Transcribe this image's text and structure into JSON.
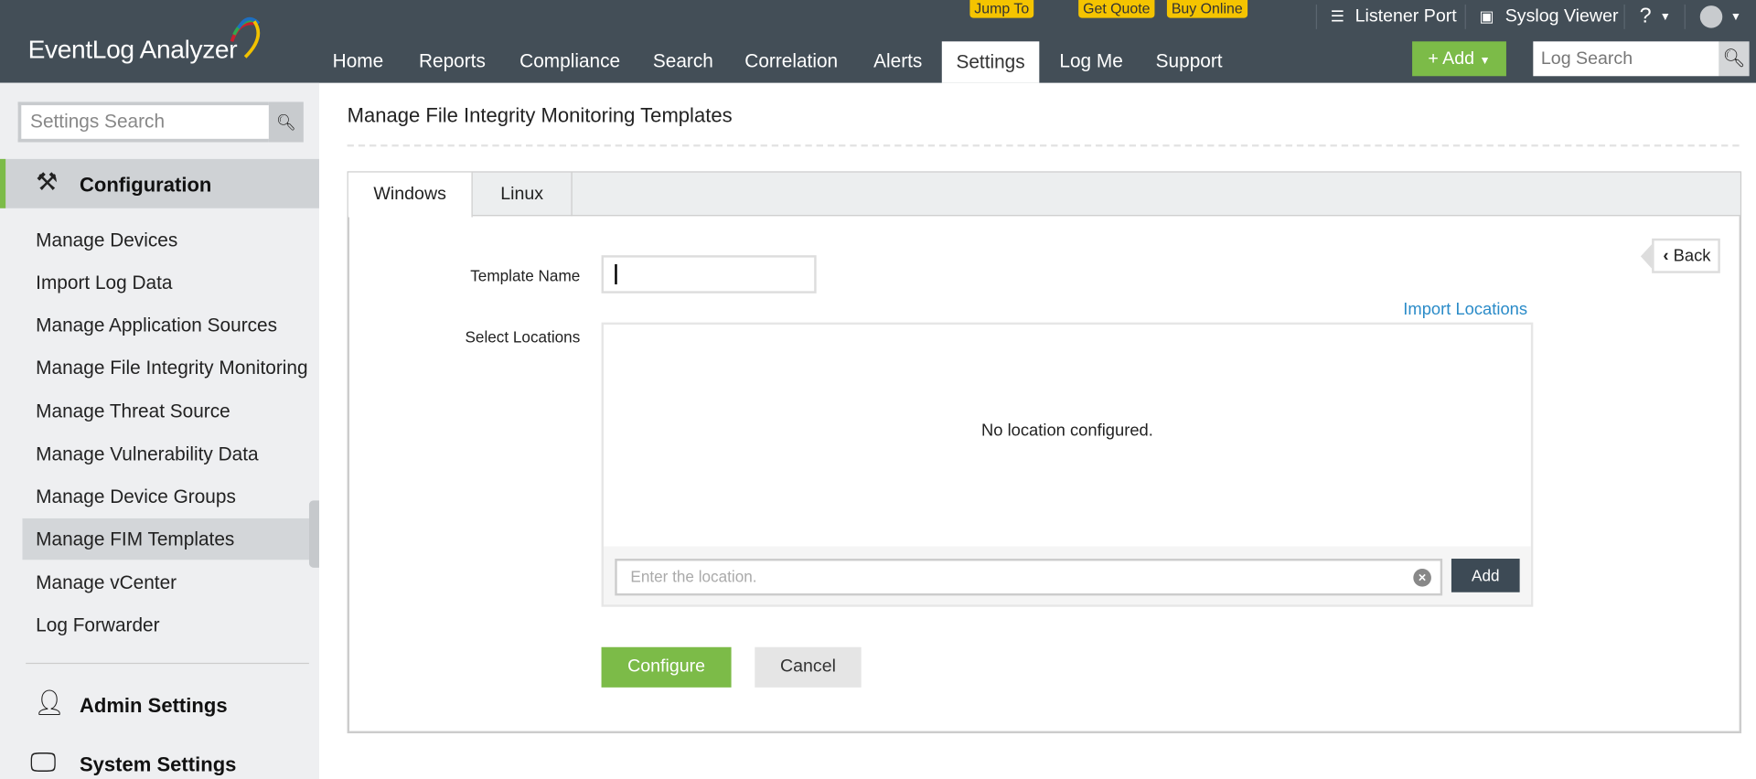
{
  "app": {
    "name": "EventLog Analyzer"
  },
  "header": {
    "nav": [
      "Home",
      "Reports",
      "Compliance",
      "Search",
      "Correlation",
      "Alerts",
      "Settings",
      "Log Me",
      "Support"
    ],
    "active_nav": "Settings",
    "badges": {
      "jump_to": "Jump To",
      "get_quote": "Get Quote",
      "buy_online": "Buy Online"
    },
    "listener_port": "Listener Port",
    "syslog_viewer": "Syslog Viewer",
    "help": "?",
    "add_label": "+ Add",
    "log_search_placeholder": "Log Search"
  },
  "sidebar": {
    "search_placeholder": "Settings Search",
    "configuration": "Configuration",
    "items": [
      "Manage Devices",
      "Import Log Data",
      "Manage Application Sources",
      "Manage File Integrity Monitoring",
      "Manage Threat Source",
      "Manage Vulnerability Data",
      "Manage Device Groups",
      "Manage FIM Templates",
      "Manage vCenter",
      "Log Forwarder"
    ],
    "selected": "Manage FIM Templates",
    "admin_settings": "Admin Settings",
    "system_settings": "System Settings"
  },
  "main": {
    "title": "Manage File Integrity Monitoring Templates",
    "tabs": [
      "Windows",
      "Linux"
    ],
    "active_tab": "Windows",
    "back": "Back",
    "template_name_label": "Template Name",
    "template_name_value": "",
    "select_locations_label": "Select Locations",
    "import_locations": "Import Locations",
    "empty_message": "No location configured.",
    "location_placeholder": "Enter the location.",
    "add": "Add",
    "configure": "Configure",
    "cancel": "Cancel"
  },
  "colors": {
    "header": "#434e57",
    "accent_green": "#7cbb48",
    "badge_yellow": "#f5c400",
    "link": "#2a8bc8"
  }
}
